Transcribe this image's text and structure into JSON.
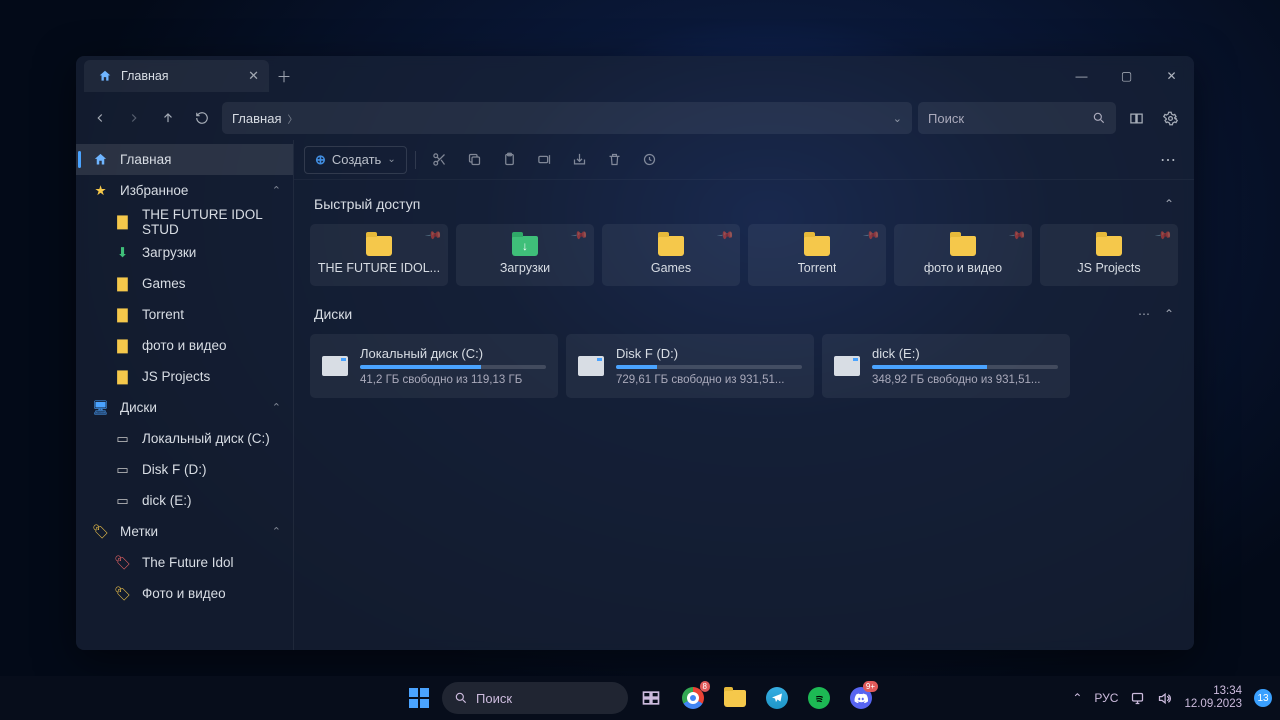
{
  "window": {
    "tab_title": "Главная",
    "breadcrumb": "Главная",
    "search_placeholder": "Поиск",
    "create_label": "Создать"
  },
  "sidebar": {
    "home": "Главная",
    "favorites": "Избранное",
    "fav_items": [
      "THE FUTURE IDOL STUD",
      "Загрузки",
      "Games",
      "Torrent",
      "фото и видео",
      "JS Projects"
    ],
    "disks": "Диски",
    "disk_items": [
      "Локальный диск (C:)",
      "Disk F (D:)",
      "dick (E:)"
    ],
    "tags": "Метки",
    "tag_items": [
      "The Future Idol",
      "Фото и видео"
    ]
  },
  "content": {
    "quick_access_label": "Быстрый доступ",
    "qa_items": [
      "THE FUTURE IDOL...",
      "Загрузки",
      "Games",
      "Torrent",
      "фото и видео",
      "JS Projects"
    ],
    "drives_label": "Диски",
    "drives": [
      {
        "name": "Локальный диск (C:)",
        "free": "41,2 ГБ свободно из 119,13 ГБ",
        "fill": 65
      },
      {
        "name": "Disk F (D:)",
        "free": "729,61 ГБ свободно из 931,51...",
        "fill": 22
      },
      {
        "name": "dick (E:)",
        "free": "348,92 ГБ свободно из 931,51...",
        "fill": 62
      }
    ]
  },
  "taskbar": {
    "search_placeholder": "Поиск",
    "lang": "РУС",
    "time": "13:34",
    "date": "12.09.2023",
    "discord_badge": "9+",
    "notif_badge": "13"
  }
}
